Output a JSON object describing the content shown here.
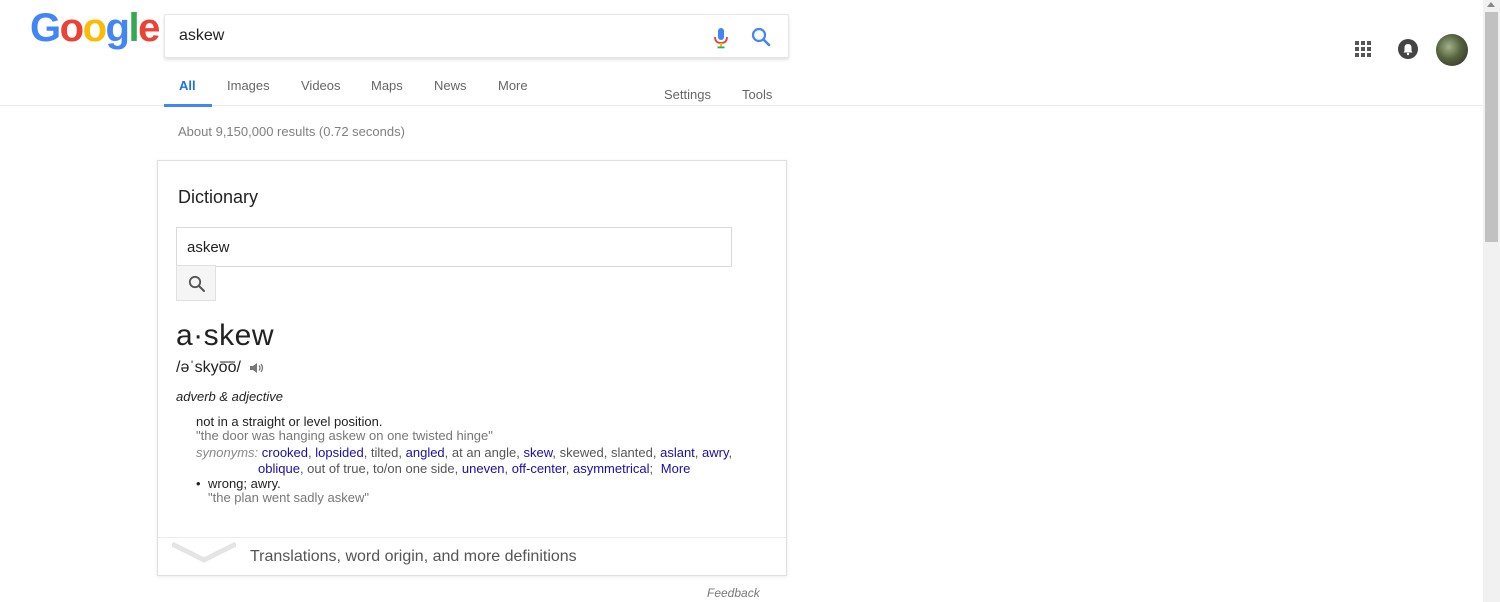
{
  "logo": {
    "letters": [
      "G",
      "o",
      "o",
      "g",
      "l",
      "e"
    ],
    "colors": [
      "#4285f4",
      "#ea4335",
      "#fbbc05",
      "#4285f4",
      "#34a853",
      "#ea4335"
    ]
  },
  "search": {
    "value": "askew"
  },
  "tabs": {
    "all": "All",
    "images": "Images",
    "videos": "Videos",
    "maps": "Maps",
    "news": "News",
    "more": "More",
    "settings": "Settings",
    "tools": "Tools"
  },
  "stats": "About 9,150,000 results (0.72 seconds)",
  "dictionary": {
    "title": "Dictionary",
    "input_value": "askew",
    "headword": "a·skew",
    "phonetic": "/əˈskyo͞o/",
    "pos": "adverb & adjective",
    "def1": {
      "text": "not in a straight or level position.",
      "example": "\"the door was hanging askew on one twisted hinge\""
    },
    "synonyms": {
      "label": "synonyms:",
      "s1": "crooked",
      "s2": "lopsided",
      "s3": "tilted",
      "s4": "angled",
      "s5": "at an angle",
      "s6": "skew",
      "s7": "skewed",
      "s8": "slanted",
      "s9": "aslant",
      "s10": "awry",
      "s11": "oblique",
      "s12": "out of true",
      "s13": "to/on one side",
      "s14": "uneven",
      "s15": "off-center",
      "s16": "asymmetrical",
      "more": "More"
    },
    "def2": {
      "text": "wrong; awry.",
      "example": "\"the plan went sadly askew\""
    },
    "footer": "Translations, word origin, and more definitions"
  },
  "feedback": "Feedback",
  "icons": {
    "mic": "mic-icon",
    "search": "search-icon",
    "apps": "apps-grid-icon",
    "notifications": "bell-icon",
    "speaker": "speaker-icon",
    "chevron": "chevron-down-icon"
  },
  "colors": {
    "accent": "#4285f4",
    "link": "#1a0dab"
  }
}
